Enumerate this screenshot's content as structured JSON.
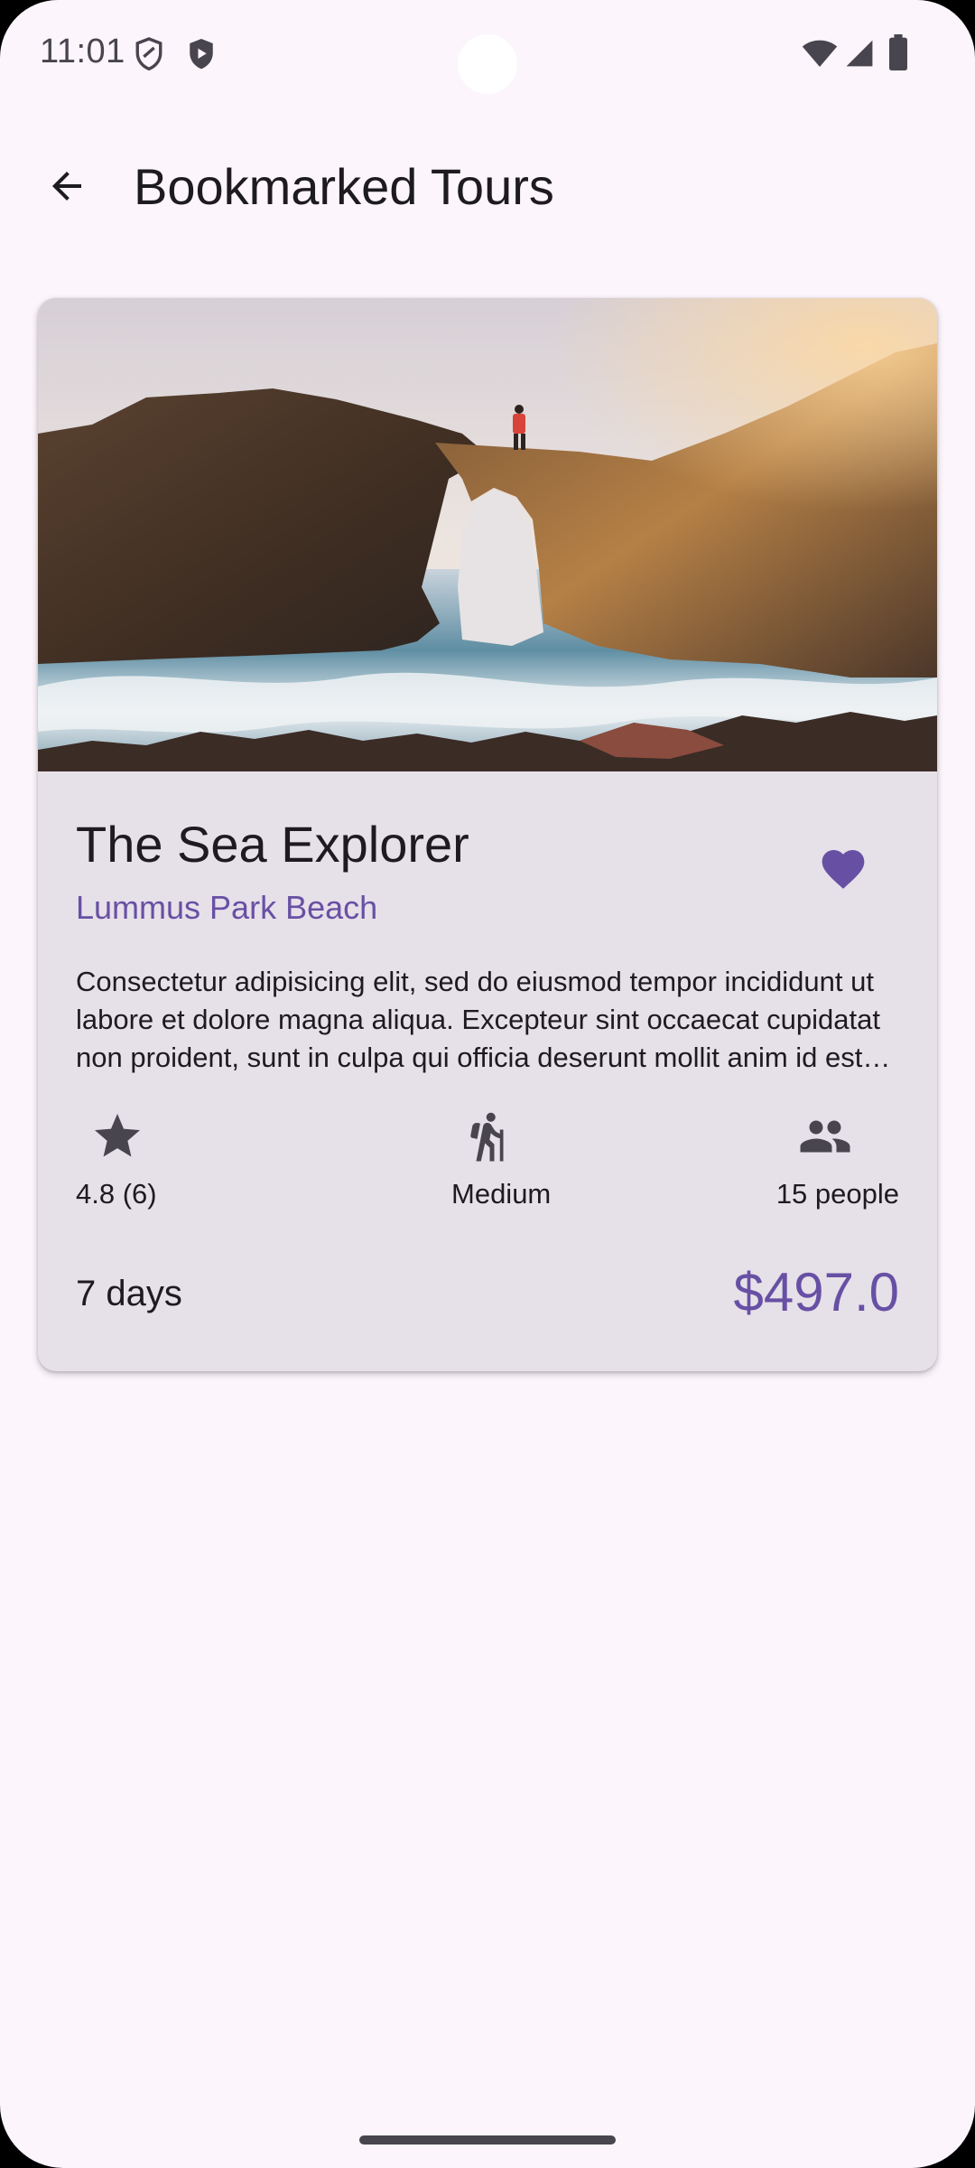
{
  "status_bar": {
    "time": "11:01",
    "left_icons": [
      "vpn-key-shield-icon",
      "play-protect-shield-icon"
    ],
    "right_icons": [
      "wifi-icon",
      "cell-signal-icon",
      "battery-icon"
    ]
  },
  "app_bar": {
    "back_icon": "arrow-back-icon",
    "title": "Bookmarked Tours"
  },
  "tours": [
    {
      "image": "sea-arch-rock-photo",
      "name": "The Sea Explorer",
      "location": "Lummus Park Beach",
      "bookmarked": true,
      "bookmark_icon": "heart-filled-icon",
      "description": "Consectetur adipisicing elit, sed do eiusmod tempor incididunt ut labore et dolore magna aliqua. Excepteur sint occaecat cupidatat non proident, sunt in culpa qui officia deserunt mollit anim id est laborum.",
      "rating": "4.8 (6)",
      "rating_icon": "star-icon",
      "difficulty": "Medium",
      "difficulty_icon": "hiking-icon",
      "group_size": "15 people",
      "group_icon": "group-icon",
      "duration": "7 days",
      "price": "$497.0"
    }
  ],
  "colors": {
    "background": "#fcf5fc",
    "card": "#e6e0e8",
    "primary": "#6750a4",
    "on_surface": "#1d1b20",
    "icon": "#49454f"
  }
}
